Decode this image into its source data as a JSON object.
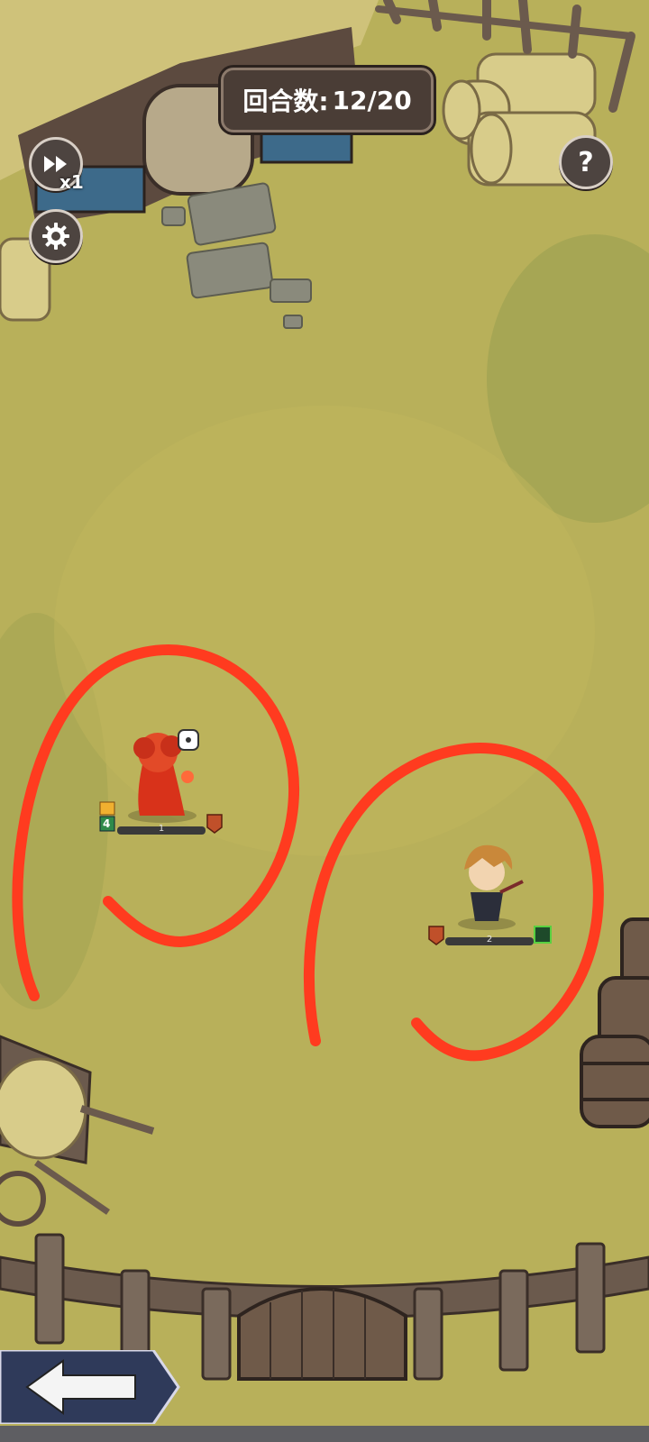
{
  "header": {
    "round_label": "回合数:",
    "round_value": "12/20"
  },
  "controls": {
    "speed_multiplier": "x1",
    "help_glyph": "?"
  },
  "units": {
    "enemy": {
      "hp_level": "1",
      "badge_number": "4"
    },
    "hero": {
      "hp_level": "2"
    }
  },
  "icons": [
    "fast-forward-icon",
    "gear-icon",
    "question-icon",
    "back-arrow-icon"
  ],
  "colors": {
    "ground": "#b5ad55",
    "annotation_red": "#ff3b1f",
    "panel": "#4a3d36"
  }
}
